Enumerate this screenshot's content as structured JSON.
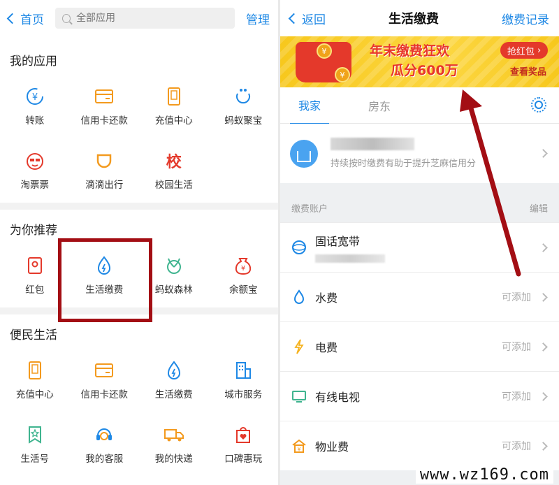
{
  "left": {
    "topbar": {
      "back_label": "首页",
      "search_placeholder": "全部应用",
      "manage_label": "管理"
    },
    "sections": [
      {
        "title": "我的应用",
        "items": [
          {
            "label": "转账",
            "icon": "transfer-icon"
          },
          {
            "label": "信用卡还款",
            "icon": "credit-card-icon"
          },
          {
            "label": "充值中心",
            "icon": "phone-recharge-icon"
          },
          {
            "label": "蚂蚁聚宝",
            "icon": "ant-fortune-icon"
          },
          {
            "label": "淘票票",
            "icon": "ticket-face-icon"
          },
          {
            "label": "滴滴出行",
            "icon": "didi-icon"
          },
          {
            "label": "校园生活",
            "icon": "campus-icon",
            "glyph": "校"
          }
        ]
      },
      {
        "title": "为你推荐",
        "items": [
          {
            "label": "红包",
            "icon": "red-packet-icon"
          },
          {
            "label": "生活缴费",
            "icon": "utility-payment-icon"
          },
          {
            "label": "蚂蚁森林",
            "icon": "ant-forest-icon"
          },
          {
            "label": "余额宝",
            "icon": "yuebao-icon"
          }
        ]
      },
      {
        "title": "便民生活",
        "items": [
          {
            "label": "充值中心",
            "icon": "phone-recharge-icon"
          },
          {
            "label": "信用卡还款",
            "icon": "credit-card-icon"
          },
          {
            "label": "生活缴费",
            "icon": "utility-payment-icon"
          },
          {
            "label": "城市服务",
            "icon": "city-service-icon"
          },
          {
            "label": "生活号",
            "icon": "life-account-icon"
          },
          {
            "label": "我的客服",
            "icon": "customer-service-icon"
          },
          {
            "label": "我的快递",
            "icon": "delivery-truck-icon"
          },
          {
            "label": "口碑惠玩",
            "icon": "koubei-icon"
          }
        ]
      }
    ]
  },
  "right": {
    "topbar": {
      "back_label": "返回",
      "title": "生活缴费",
      "record_label": "缴费记录"
    },
    "banner": {
      "headline": "年末缴费狂欢",
      "subline": "瓜分600万",
      "grab_label": "抢红包",
      "prize_label": "查看奖品"
    },
    "tabs": [
      "我家",
      "房东"
    ],
    "house": {
      "hint": "持续按时缴费有助于提升芝麻信用分"
    },
    "accounts": {
      "header": "缴费账户",
      "edit_label": "编辑",
      "items": [
        {
          "name": "固话宽带",
          "status": "",
          "icon": "broadband-icon"
        },
        {
          "name": "水费",
          "status": "可添加",
          "icon": "water-drop-icon"
        },
        {
          "name": "电费",
          "status": "可添加",
          "icon": "lightning-icon"
        },
        {
          "name": "有线电视",
          "status": "可添加",
          "icon": "tv-icon"
        },
        {
          "name": "物业费",
          "status": "可添加",
          "icon": "property-fee-icon"
        }
      ]
    }
  },
  "watermark": "www.wz169.com",
  "colors": {
    "accent": "#1e88e5",
    "highlight": "#a30e14",
    "orange": "#f39a1e",
    "green": "#3fb48f",
    "red": "#e4392b"
  }
}
